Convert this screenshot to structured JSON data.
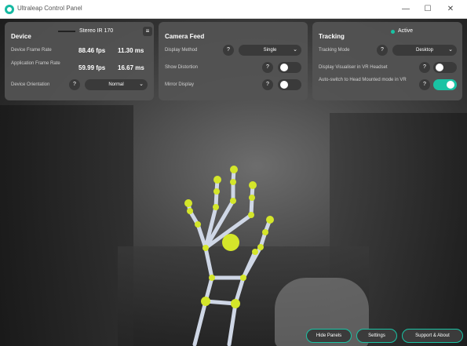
{
  "window": {
    "title": "Ultraleap Control Panel",
    "min_glyph": "—",
    "max_glyph": "☐",
    "close_glyph": "✕"
  },
  "device": {
    "title": "Device",
    "device_name": "Stereo IR 170",
    "rows": {
      "frame_rate_label": "Device Frame Rate",
      "frame_rate_fps": "88.46 fps",
      "frame_rate_ms": "11.30 ms",
      "app_rate_label": "Application Frame Rate",
      "app_rate_fps": "59.99 fps",
      "app_rate_ms": "16.67 ms",
      "orientation_label": "Device Orientation",
      "orientation_value": "Normal"
    }
  },
  "camera": {
    "title": "Camera Feed",
    "display_method_label": "Display Method",
    "display_method_value": "Single",
    "show_distortion_label": "Show Distortion",
    "show_distortion_on": false,
    "mirror_display_label": "Mirror Display",
    "mirror_display_on": false
  },
  "tracking": {
    "title": "Tracking",
    "status": "Active",
    "status_color": "#19c3a4",
    "mode_label": "Tracking Mode",
    "mode_value": "Desktop",
    "visualiser_label": "Display Visualiser in VR Headset",
    "visualiser_on": false,
    "auto_switch_label": "Auto-switch to Head Mounted mode in VR",
    "auto_switch_on": true
  },
  "help_glyph": "?",
  "chevron_glyph": "⌄",
  "bottom_buttons": {
    "hide_panels": "Hide Panels",
    "settings": "Settings",
    "support": "Support & About"
  },
  "colors": {
    "accent": "#19c3a4",
    "joint": "#d4e62a",
    "bone": "#cfd7e6"
  }
}
